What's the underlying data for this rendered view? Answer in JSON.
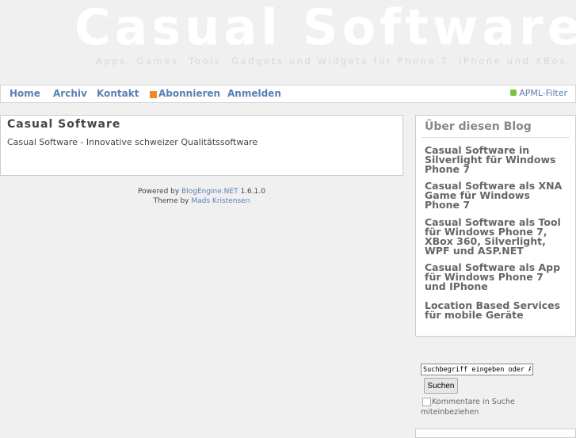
{
  "header": {
    "title": "Casual Software",
    "tagline": "Apps, Games, Tools, Gadgets und Widgets für Phone 7, IPhone und XBox."
  },
  "nav": {
    "items": [
      "Home",
      "Archiv",
      "Kontakt",
      "Abonnieren",
      "Anmelden"
    ],
    "apml": "APML-Filter"
  },
  "post": {
    "title": "Casual Software",
    "text": "Casual Software - Innovative schweizer Qualitätssoftware"
  },
  "footer": {
    "powered": "Powered by",
    "engine": "BlogEngine.NET",
    "version": "1.6.1.0",
    "theme": "Theme by",
    "author": "Mads Kristensen"
  },
  "sidebar": {
    "title": "Über diesen Blog",
    "links": [
      "Casual Software in Silverlight für Windows Phone 7",
      "Casual Software als XNA Game für Windows Phone 7",
      "Casual Software als Tool für Windows Phone 7, XBox 360, Silverlight, WPF und ASP.NET",
      "Casual Software als App für Windows Phone 7 und IPhone",
      "Location Based Services für mobile Geräte"
    ]
  },
  "search": {
    "value": "Suchbegriff eingeben oder APM",
    "button": "Suchen",
    "checkbox": "Kommentare in Suche miteinbeziehen"
  }
}
